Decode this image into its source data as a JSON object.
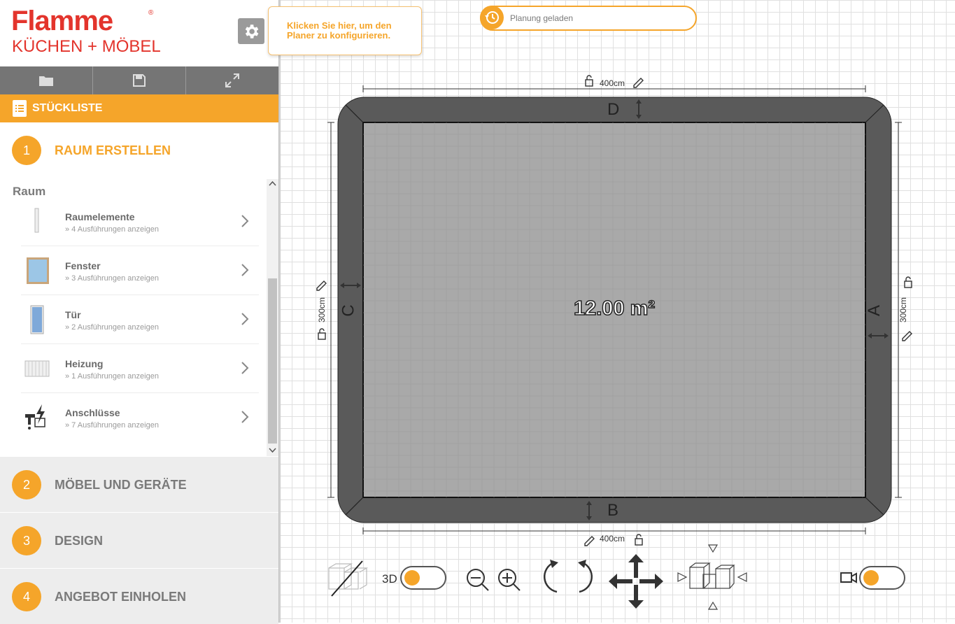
{
  "brand": {
    "name": "Flamme",
    "reg": "®",
    "subtitle": "KÜCHEN + MÖBEL"
  },
  "tooltip": {
    "text": "Klicken Sie hier, um den Planer zu konfigurieren."
  },
  "status": {
    "text": "Planung geladen"
  },
  "toolbar": {
    "icons": [
      "folder-icon",
      "save-icon",
      "fullscreen-icon"
    ]
  },
  "stueckliste": {
    "label": "STÜCKLISTE"
  },
  "steps": [
    {
      "num": "1",
      "label": "RAUM ERSTELLEN",
      "active": true
    },
    {
      "num": "2",
      "label": "MÖBEL UND GERÄTE"
    },
    {
      "num": "3",
      "label": "DESIGN"
    },
    {
      "num": "4",
      "label": "ANGEBOT EINHOLEN"
    }
  ],
  "section": {
    "title": "Raum"
  },
  "items": [
    {
      "title": "Raumelemente",
      "sub": "» 4 Ausführungen anzeigen"
    },
    {
      "title": "Fenster",
      "sub": "» 3 Ausführungen anzeigen"
    },
    {
      "title": "Tür",
      "sub": "» 2 Ausführungen anzeigen"
    },
    {
      "title": "Heizung",
      "sub": "» 1 Ausführungen anzeigen"
    },
    {
      "title": "Anschlüsse",
      "sub": "» 7 Ausführungen anzeigen"
    }
  ],
  "room": {
    "area": "12.00 m²",
    "walls": {
      "top": "D",
      "bottom": "B",
      "left": "C",
      "right": "A"
    },
    "dims": {
      "top": "400cm",
      "bottom": "400cm",
      "left": "300cm",
      "right": "300cm"
    }
  },
  "controls": {
    "view3d_label": "3D"
  },
  "colors": {
    "accent": "#f5a52a",
    "brand": "#e3342c",
    "wall": "#5a5a5a",
    "floor": "#a9a9a9"
  }
}
